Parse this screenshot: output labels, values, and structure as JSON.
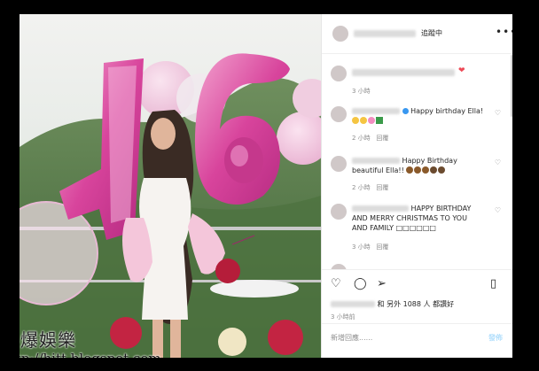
{
  "header": {
    "follow_label": "追蹤中",
    "more_label": "•••"
  },
  "caption": {
    "meta": "3 小時",
    "heart": "❤"
  },
  "comments": [
    {
      "text": "Happy birthday Ella!",
      "time": "2 小時",
      "reply": "回覆"
    },
    {
      "text": "Happy Birthday beautiful Ella!!",
      "time": "2 小時",
      "reply": "回覆"
    },
    {
      "text": "HAPPY BIRTHDAY AND MERRY CHRISTMAS TO YOU AND FAMILY □□□□□□",
      "time": "3 小時",
      "reply": "回覆"
    }
  ],
  "actions": {
    "likes_text": "和 另外 1088 人 都讚好",
    "date": "3 小時前"
  },
  "add_comment": {
    "placeholder": "新增回應......",
    "post_label": "發佈"
  },
  "photo": {
    "number": "16",
    "watermark_text": "熱爆娛樂",
    "watermark_url": "http://hitt.blogspot.com"
  },
  "colors": {
    "balloon": "#d63a9a",
    "like_heart": "#ed4956",
    "post_button_disabled": "#b2dffc"
  }
}
